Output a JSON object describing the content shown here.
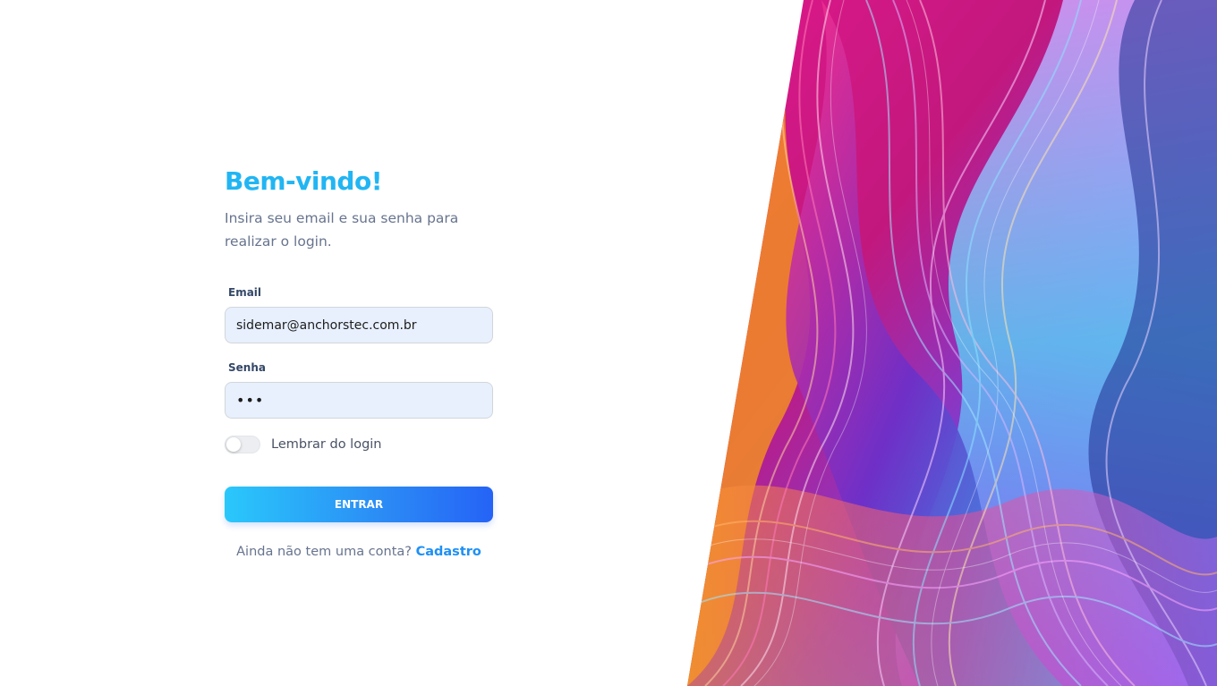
{
  "login": {
    "title": "Bem-vindo!",
    "subtitle": "Insira seu email e sua senha para realizar o login.",
    "email_label": "Email",
    "email_value": "sidemar@anchorstec.com.br",
    "password_label": "Senha",
    "password_value": "•••",
    "remember_label": "Lembrar do login",
    "remember_checked": false,
    "submit_label": "ENTRAR",
    "signup_prompt": "Ainda não tem uma conta?",
    "signup_link": "Cadastro"
  },
  "colors": {
    "accent": "#21b5f3",
    "button_start": "#2ac8fb",
    "button_end": "#2563f6",
    "link": "#1e90f5",
    "input_bg": "#e8f0fe"
  }
}
